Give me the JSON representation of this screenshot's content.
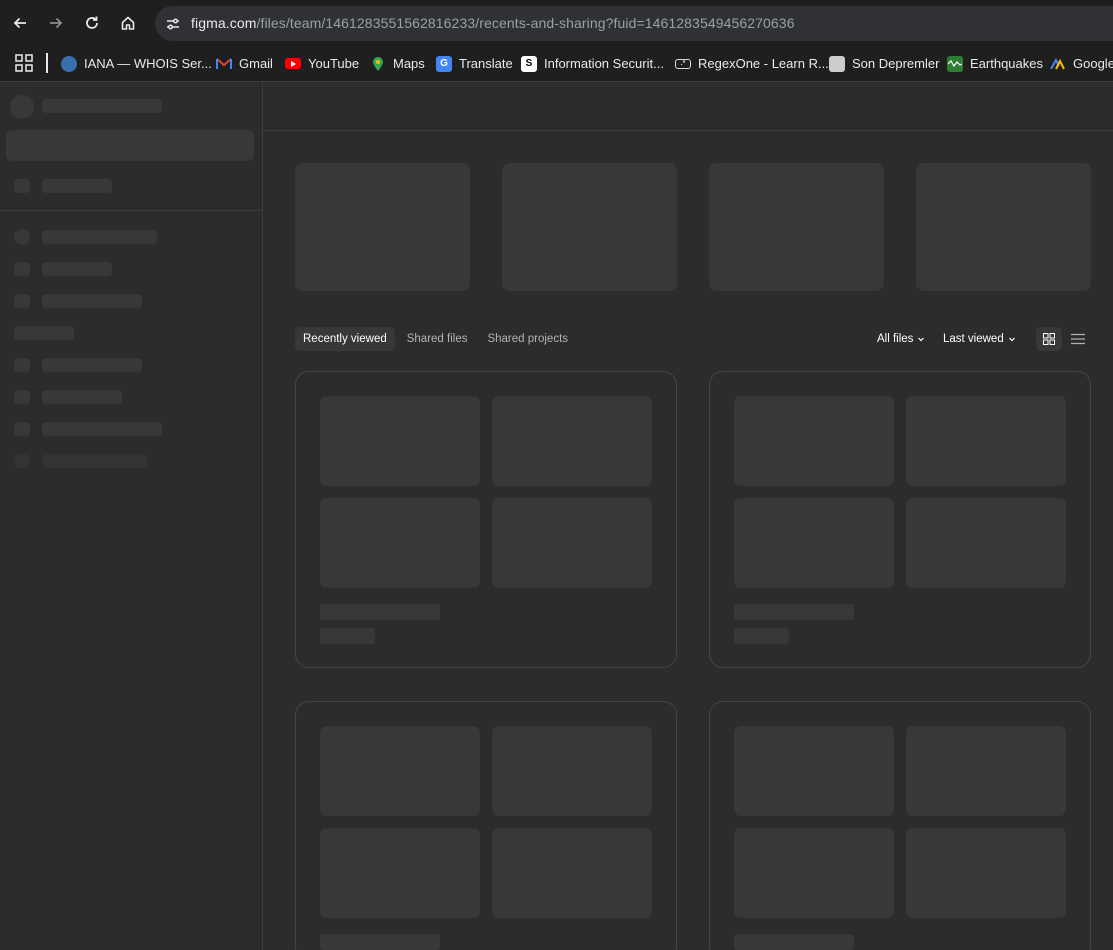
{
  "browser": {
    "url_host": "figma.com",
    "url_path": "/files/team/1461283551562816233/recents-and-sharing?fuid=1461283549456270636",
    "bookmarks": [
      {
        "label": "IANA — WHOIS Ser...",
        "icon": "globe-icon",
        "color": "#4a8fd8"
      },
      {
        "label": "Gmail",
        "icon": "gmail-icon",
        "color": "#ea4335"
      },
      {
        "label": "YouTube",
        "icon": "youtube-icon",
        "color": "#ff0000"
      },
      {
        "label": "Maps",
        "icon": "maps-pin-icon",
        "color": "#34a853"
      },
      {
        "label": "Translate",
        "icon": "translate-icon",
        "color": "#4285f4"
      },
      {
        "label": "Information Securit...",
        "icon": "infosec-icon",
        "color": "#ffffff"
      },
      {
        "label": "RegexOne - Learn R...",
        "icon": "regex-icon",
        "color": "#dddddd"
      },
      {
        "label": "Son Depremler",
        "icon": "earthquake-icon",
        "color": "#cccccc"
      },
      {
        "label": "Earthquakes",
        "icon": "wave-chart-icon",
        "color": "#3fa34d"
      },
      {
        "label": "Google",
        "icon": "google-icon",
        "color": "#fbbc05"
      }
    ]
  },
  "tabs": [
    {
      "label": "Recently viewed",
      "active": true
    },
    {
      "label": "Shared files",
      "active": false
    },
    {
      "label": "Shared projects",
      "active": false
    }
  ],
  "filters": {
    "files": "All files",
    "sort": "Last viewed"
  },
  "colors": {
    "background": "#2c2c2c",
    "skeleton": "#383838",
    "chrome": "#1f1f1f"
  }
}
